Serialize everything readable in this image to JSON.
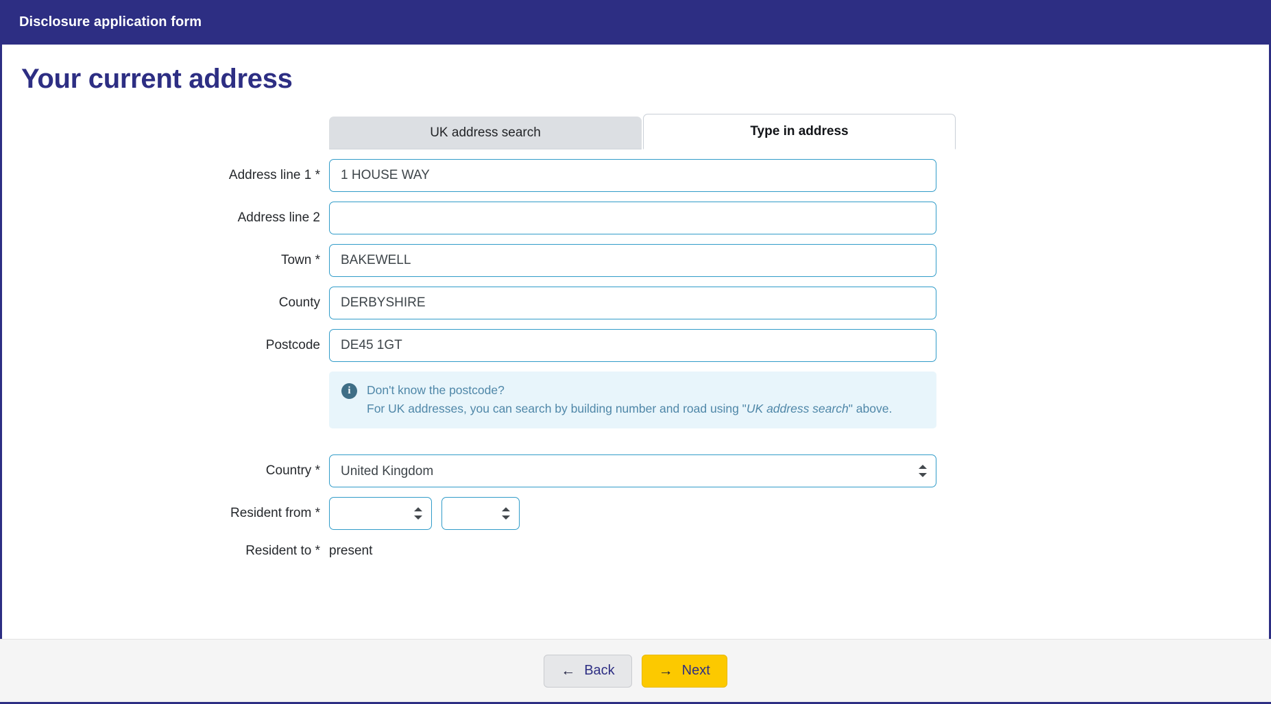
{
  "app": {
    "title": "Disclosure application form",
    "header_bg": "#2d2e83"
  },
  "page": {
    "heading": "Your current address"
  },
  "tabs": [
    {
      "label": "UK address search",
      "active": false
    },
    {
      "label": "Type in address",
      "active": true
    }
  ],
  "form": {
    "address_line_1": {
      "label": "Address line 1",
      "required": "*",
      "value": "1 HOUSE WAY",
      "placeholder": ""
    },
    "address_line_2": {
      "label": "Address line 2",
      "required": "",
      "value": "",
      "placeholder": ""
    },
    "town": {
      "label": "Town",
      "required": "*",
      "value": "BAKEWELL",
      "placeholder": ""
    },
    "county": {
      "label": "County",
      "required": "",
      "value": "DERBYSHIRE",
      "placeholder": ""
    },
    "postcode": {
      "label": "Postcode",
      "required": "",
      "value": "DE45 1GT",
      "placeholder": ""
    },
    "info": {
      "icon": "info-icon",
      "line1": "Don't know the postcode?",
      "line2_pre": "For UK addresses, you can search by building number and road using \"",
      "line2_em": "UK address search",
      "line2_post": "\" above."
    },
    "country": {
      "label": "Country",
      "required": "*",
      "value": "United Kingdom",
      "options": [
        "United Kingdom"
      ]
    },
    "resident_from": {
      "label": "Resident from",
      "required": "*",
      "month_value": "",
      "year_value": "",
      "month_options": [
        ""
      ],
      "year_options": [
        ""
      ]
    },
    "resident_to": {
      "label": "Resident to",
      "required": "*",
      "value": "present"
    }
  },
  "footer": {
    "back": {
      "label": "Back",
      "icon": "arrow-left-icon",
      "glyph": "←"
    },
    "next": {
      "label": "Next",
      "icon": "arrow-right-icon",
      "glyph": "→",
      "color": "#fcc900"
    }
  }
}
